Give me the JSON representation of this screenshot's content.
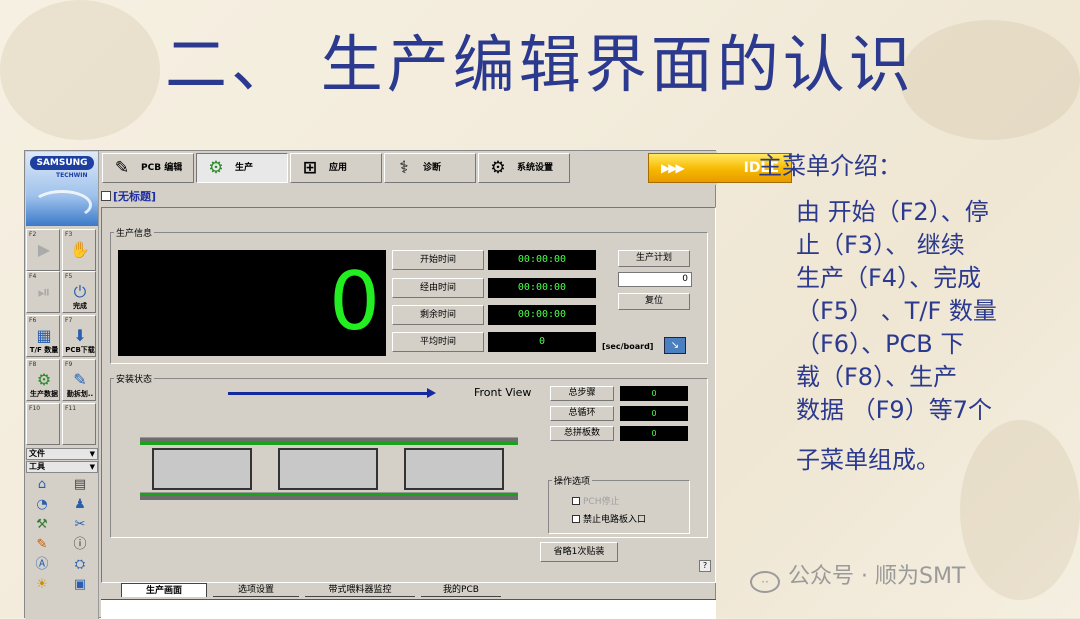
{
  "slide": {
    "title": "二、 生产编辑界面的认识"
  },
  "app": {
    "brand": "SAMSUNG",
    "brand_sub": "TECHWIN",
    "fkeys": [
      {
        "fn": "F2",
        "label": "",
        "icon": "play-icon",
        "glyph": "▶"
      },
      {
        "fn": "F3",
        "label": "",
        "icon": "hand-stop-icon",
        "glyph": "✋"
      },
      {
        "fn": "F4",
        "label": "",
        "icon": "resume-icon",
        "glyph": "⏯"
      },
      {
        "fn": "F5",
        "label": "完成",
        "icon": "finish-icon",
        "glyph": "⏻"
      },
      {
        "fn": "F6",
        "label": "T/F 数量",
        "icon": "grid-icon",
        "glyph": "▦"
      },
      {
        "fn": "F7",
        "label": "PCB下载",
        "icon": "download-icon",
        "glyph": "⬇"
      },
      {
        "fn": "F8",
        "label": "生产数据",
        "icon": "gear-data-icon",
        "glyph": "⚙"
      },
      {
        "fn": "F9",
        "label": "勤拆划..",
        "icon": "tool-icon",
        "glyph": "✎"
      },
      {
        "fn": "F10",
        "label": "",
        "icon": "blank-icon",
        "glyph": ""
      },
      {
        "fn": "F11",
        "label": "",
        "icon": "blank-icon",
        "glyph": ""
      }
    ],
    "menu_file": "文件",
    "menu_tools": "工具",
    "toolbar": {
      "pcb_edit": "PCB 编辑",
      "production": "生产",
      "apply": "应用",
      "diagnose": "诊断",
      "system_settings": "系统设置",
      "status": "IDLE",
      "status_arrows": "▶▶▶"
    },
    "doc_title": "[无标题]",
    "production_info": {
      "group_label": "生产信息",
      "count": "0",
      "time_labels": [
        "开始时间",
        "经由时间",
        "剩余时间",
        "平均时间"
      ],
      "time_values": [
        "00:00:00",
        "00:00:00",
        "00:00:00",
        "0"
      ],
      "plan_label": "生产计划",
      "plan_value": "0",
      "reset_label": "复位",
      "unit": "[sec/board]"
    },
    "mount_status": {
      "group_label": "安装状态",
      "front_view": "Front View",
      "stat_labels": [
        "总步骤",
        "总循环",
        "总拼板数"
      ],
      "stat_values": [
        "0",
        "0",
        "0"
      ],
      "options_label": "操作选项",
      "options": [
        {
          "label": "PCH停止",
          "disabled": true
        },
        {
          "label": "禁止电路板入口",
          "disabled": false
        }
      ],
      "skip_button": "省略1次贴装",
      "help": "?"
    },
    "tabs": [
      "生产画面",
      "选项设置",
      "带式喂料器监控",
      "我的PCB"
    ]
  },
  "right_panel": {
    "heading": "主菜单介绍：",
    "lines": [
      "由 开始（F2）、停",
      "止（F3）、 继续",
      "生产（F4）、完成",
      "（F5） 、T/F 数量",
      "（F6）、PCB 下",
      "载（F8）、生产",
      "数据 （F9）等7个"
    ],
    "tail": "子菜单组成。"
  },
  "watermark": "公众号 · 顺为SMT",
  "colors": {
    "title": "#2b3a8f",
    "display_green": "#22ee22",
    "idle_orange": "#f7b800",
    "arrow_blue": "#1428a0"
  }
}
